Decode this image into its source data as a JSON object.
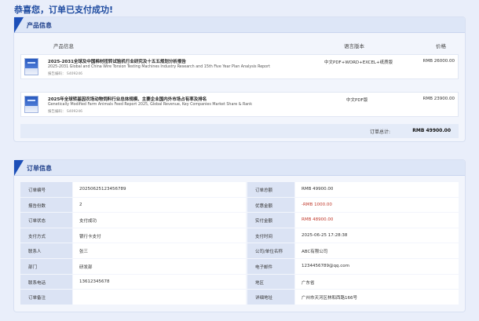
{
  "page_title": "恭喜您，订单已支付成功!",
  "product_section": {
    "title": "产品信息",
    "headers": {
      "info": "产品信息",
      "version": "语言版本",
      "price": "价格"
    },
    "items": [
      {
        "title_cn": "2025-2031全球及中国棉材扭转试验机行业研究及十五五规划分析报告",
        "title_en": "2025-2031 Global and China Wire Torsion Testing Machines Industry Research and 15th Five Year Plan Analysis Report",
        "code": "报告编码：  S409246",
        "version": "中文PDF+WORD+EXCEL+纸质版",
        "price": "RMB 26000.00"
      },
      {
        "title_cn": "2025年全球转基因农场动物饲料行业总体规模、主要企业国内外市场占有率及排名",
        "title_en": "Genetically Modified Farm Animals Feed Report 2025, Global Revenue, Key Companies Market Share & Rank",
        "code": "报告编码：  S409246",
        "version": "中文PDF版",
        "price": "RMB 23900.00"
      }
    ],
    "total_label": "订单总计:",
    "total_value": "RMB 49900.00"
  },
  "order_section": {
    "title": "订单信息",
    "rows": [
      {
        "l_label": "订单编号",
        "l_value": "20250625123456789",
        "r_label": "订单总额",
        "r_value": "RMB 49900.00",
        "r_red": false
      },
      {
        "l_label": "报告份数",
        "l_value": "2",
        "r_label": "优惠金额",
        "r_value": "-RMB 1000.00",
        "r_red": true
      },
      {
        "l_label": "订单状态",
        "l_value": "支付成功",
        "r_label": "实付金额",
        "r_value": "RMB 48900.00",
        "r_red": true
      },
      {
        "l_label": "支付方式",
        "l_value": "银行卡支付",
        "r_label": "支付时间",
        "r_value": "2025-06-25  17:28:38",
        "r_red": false
      },
      {
        "l_label": "联系人",
        "l_value": "张三",
        "r_label": "公司/单位名称",
        "r_value": "ABC有限公司",
        "r_red": false
      },
      {
        "l_label": "部门",
        "l_value": "研发部",
        "r_label": "电子邮件",
        "r_value": "1234456789@qq.com",
        "r_red": false
      },
      {
        "l_label": "联系电话",
        "l_value": "13612345678",
        "r_label": "地区",
        "r_value": "广东省",
        "r_red": false
      },
      {
        "l_label": "订单备注",
        "l_value": "",
        "r_label": "详细地址",
        "r_value": "广州市天河区林和西路166号",
        "r_red": false
      }
    ]
  },
  "colors": {
    "accent": "#1d4fb8",
    "highlight_red": "#c0392b"
  },
  "icons": {
    "section_marker": "corner-triangle-icon",
    "product_thumb": "report-cover-icon"
  }
}
